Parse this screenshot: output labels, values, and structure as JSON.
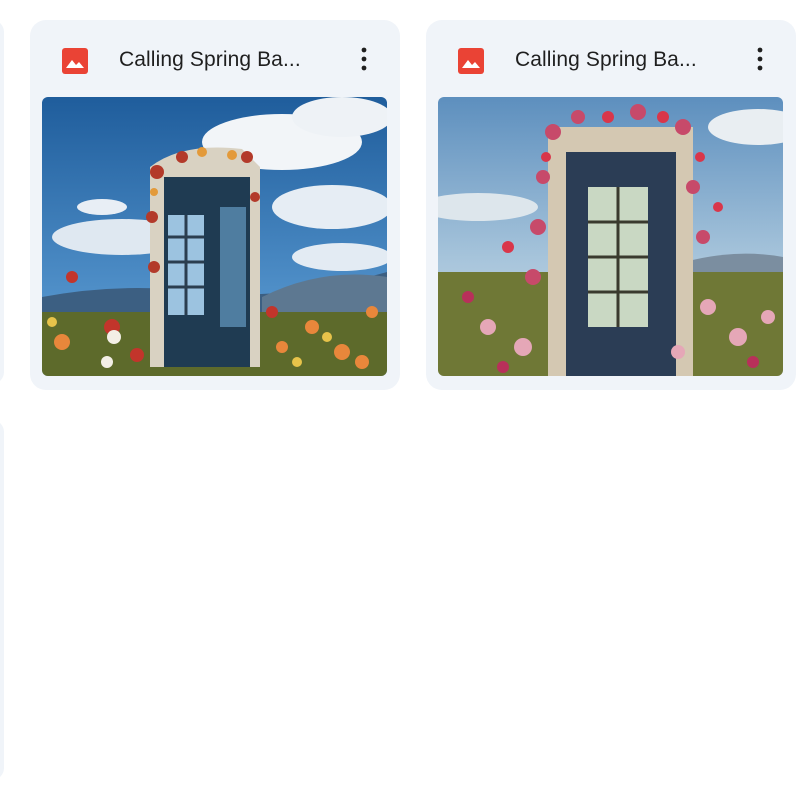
{
  "files": [
    {
      "name": "Calling Spring Ba...",
      "type_icon": "image-file-icon",
      "thumbnail": "phone-booth-flowers-image-1"
    },
    {
      "name": "Calling Spring Ba...",
      "type_icon": "image-file-icon",
      "thumbnail": "phone-booth-flowers-image-2"
    }
  ],
  "colors": {
    "card_bg": "#f0f4f9",
    "image_icon": "#ea4335",
    "title_text": "#1f1f1f"
  }
}
